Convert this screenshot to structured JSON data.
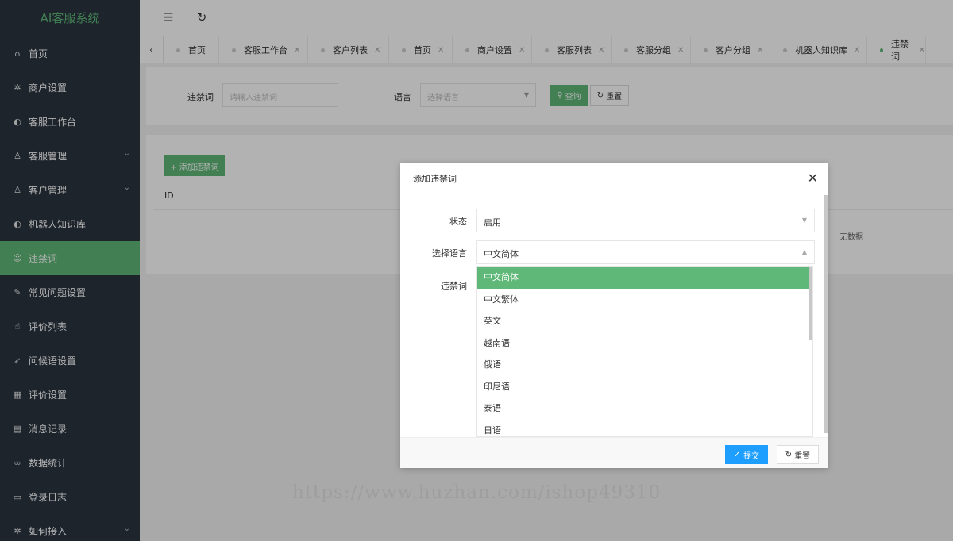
{
  "app": {
    "title": "AI客服系统"
  },
  "header": {
    "collapse_icon": "menu-fold-icon",
    "refresh_icon": "refresh-icon"
  },
  "sidebar": {
    "items": [
      {
        "label": "首页",
        "icon": "home-icon",
        "glyph": "⌂",
        "active": false,
        "has_submenu": false
      },
      {
        "label": "商户设置",
        "icon": "gear-icon",
        "glyph": "✲",
        "active": false,
        "has_submenu": false
      },
      {
        "label": "客服工作台",
        "icon": "service-icon",
        "glyph": "◐",
        "active": false,
        "has_submenu": false
      },
      {
        "label": "客服管理",
        "icon": "user-icon",
        "glyph": "♙",
        "active": false,
        "has_submenu": true
      },
      {
        "label": "客户管理",
        "icon": "users-icon",
        "glyph": "♙",
        "active": false,
        "has_submenu": true
      },
      {
        "label": "机器人知识库",
        "icon": "robot-icon",
        "glyph": "◐",
        "active": false,
        "has_submenu": false
      },
      {
        "label": "违禁词",
        "icon": "face-icon",
        "glyph": "☺",
        "active": true,
        "has_submenu": false
      },
      {
        "label": "常见问题设置",
        "icon": "edit-icon",
        "glyph": "✎",
        "active": false,
        "has_submenu": false
      },
      {
        "label": "评价列表",
        "icon": "thumb-up-icon",
        "glyph": "☝",
        "active": false,
        "has_submenu": false
      },
      {
        "label": "问候语设置",
        "icon": "send-icon",
        "glyph": "➶",
        "active": false,
        "has_submenu": false
      },
      {
        "label": "评价设置",
        "icon": "calendar-icon",
        "glyph": "▦",
        "active": false,
        "has_submenu": false
      },
      {
        "label": "消息记录",
        "icon": "note-icon",
        "glyph": "▤",
        "active": false,
        "has_submenu": false
      },
      {
        "label": "数据统计",
        "icon": "chart-icon",
        "glyph": "∞",
        "active": false,
        "has_submenu": false
      },
      {
        "label": "登录日志",
        "icon": "log-icon",
        "glyph": "▭",
        "active": false,
        "has_submenu": false
      },
      {
        "label": "如何接入",
        "icon": "plug-icon",
        "glyph": "✲",
        "active": false,
        "has_submenu": true
      }
    ]
  },
  "tabs": [
    {
      "label": "首页",
      "closable": false,
      "active": false
    },
    {
      "label": "客服工作台",
      "closable": true,
      "active": false
    },
    {
      "label": "客户列表",
      "closable": true,
      "active": false
    },
    {
      "label": "首页",
      "closable": true,
      "active": false
    },
    {
      "label": "商户设置",
      "closable": true,
      "active": false
    },
    {
      "label": "客服列表",
      "closable": true,
      "active": false
    },
    {
      "label": "客服分组",
      "closable": true,
      "active": false
    },
    {
      "label": "客户分组",
      "closable": true,
      "active": false
    },
    {
      "label": "机器人知识库",
      "closable": true,
      "active": false
    },
    {
      "label": "违禁词",
      "closable": true,
      "active": true
    }
  ],
  "search": {
    "word_label": "违禁词",
    "word_placeholder": "请输入违禁词",
    "lang_label": "语言",
    "lang_placeholder": "选择语言",
    "query_label": "查询",
    "reset_label": "重置"
  },
  "list": {
    "add_label": "+ 添加违禁词",
    "col_id": "ID",
    "empty_text": "无数据"
  },
  "dialog": {
    "title": "添加违禁词",
    "status_label": "状态",
    "status_value": "启用",
    "lang_label": "选择语言",
    "lang_value": "中文简体",
    "word_label": "违禁词",
    "lang_options": [
      "中文简体",
      "中文繁体",
      "英文",
      "越南语",
      "俄语",
      "印尼语",
      "泰语",
      "日语"
    ],
    "selected_index": 0,
    "submit_label": "提交",
    "reset_label": "重置"
  },
  "watermark": "https://www.huzhan.com/ishop49310",
  "colors": {
    "accent": "#5fb878",
    "primary": "#1e9fff",
    "sidebar": "#2a3440"
  }
}
